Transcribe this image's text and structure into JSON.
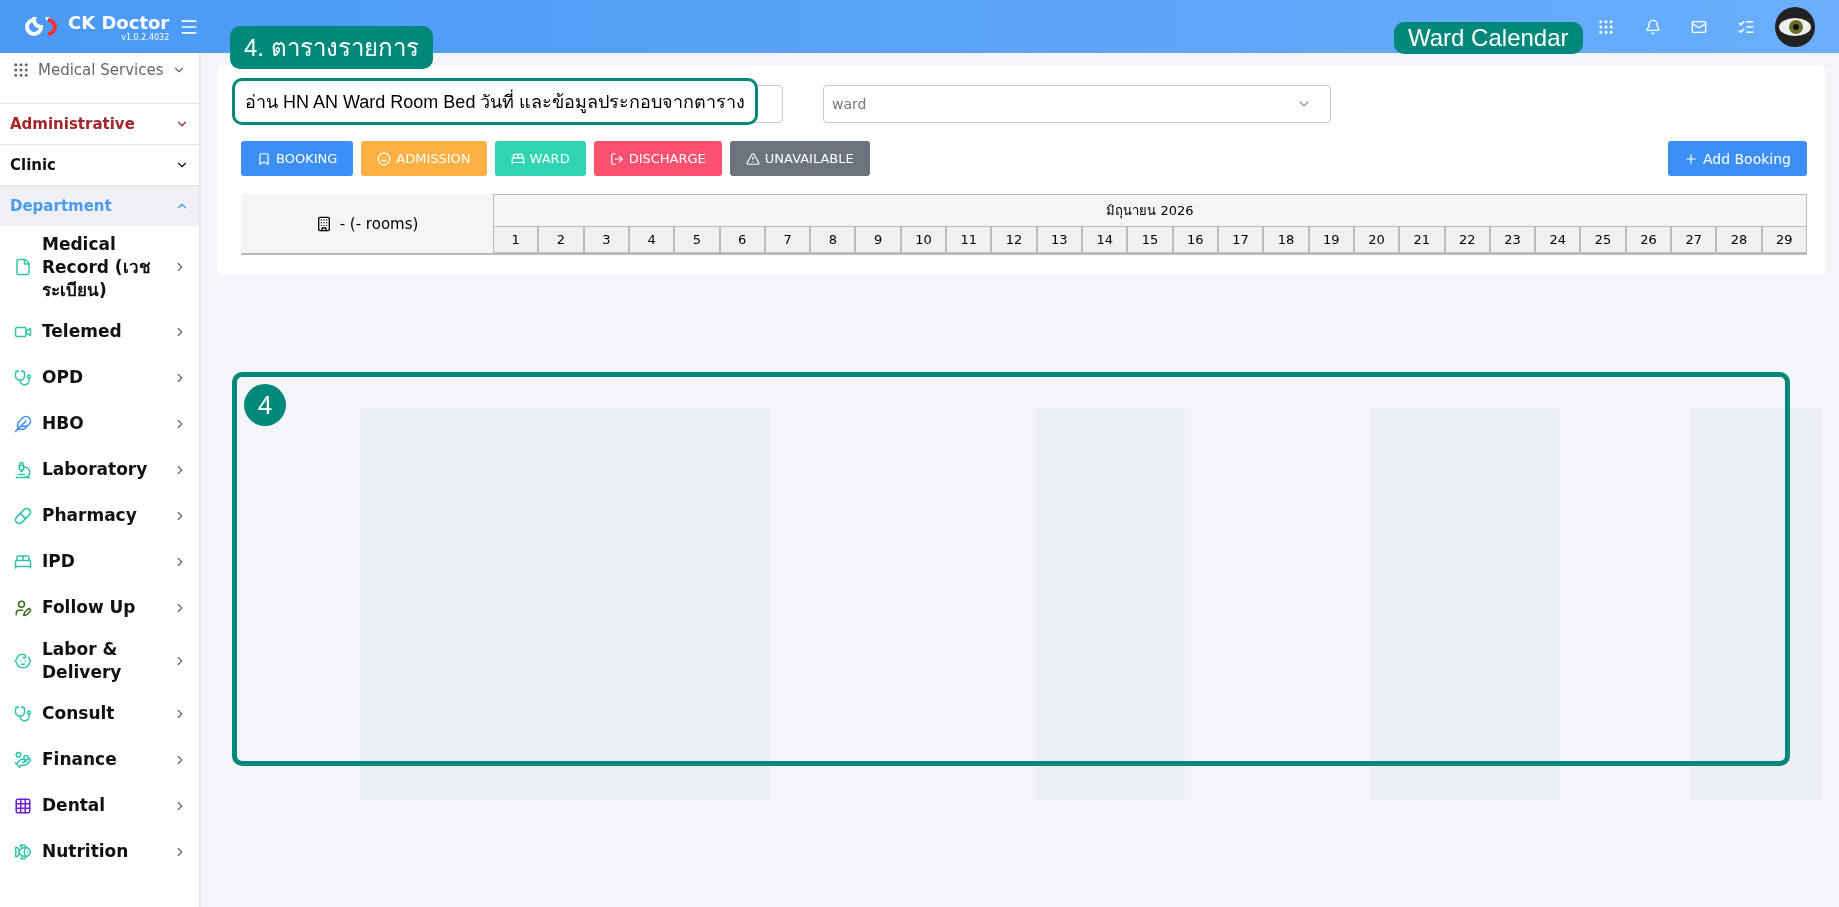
{
  "header": {
    "brand": "CK Doctor",
    "version": "v1.0.2.4032"
  },
  "sidebar": {
    "services": "Medical Services",
    "groups": [
      {
        "label": "Administrative",
        "expanded": false,
        "color": "#a3262a"
      },
      {
        "label": "Clinic",
        "expanded": false,
        "color": "#111111"
      },
      {
        "label": "Department",
        "expanded": true,
        "color": "#4a9af0"
      }
    ],
    "items": [
      "Medical Record (เวชระเบียน)",
      "Telemed",
      "OPD",
      "HBO",
      "Laboratory",
      "Pharmacy",
      "IPD",
      "Follow Up",
      "Labor & Delivery",
      "Consult",
      "Finance",
      "Dental",
      "Nutrition"
    ]
  },
  "filters": {
    "ward_placeholder": "ward"
  },
  "legend": [
    {
      "label": "BOOKING",
      "color": "#3d8ef5"
    },
    {
      "label": "ADMISSION",
      "color": "#fdb144"
    },
    {
      "label": "WARD",
      "color": "#2fd4b3"
    },
    {
      "label": "DISCHARGE",
      "color": "#fd5170"
    },
    {
      "label": "UNAVAILABLE",
      "color": "#6c737c"
    }
  ],
  "add_button": "Add Booking",
  "calendar": {
    "rooms": "- (- rooms)",
    "month": "มิถุนายน 2026",
    "days": [
      "1",
      "2",
      "3",
      "4",
      "5",
      "6",
      "7",
      "8",
      "9",
      "10",
      "11",
      "12",
      "13",
      "14",
      "15",
      "16",
      "17",
      "18",
      "19",
      "20",
      "21",
      "22",
      "23",
      "24",
      "25",
      "26",
      "27",
      "28",
      "29"
    ]
  },
  "annotations": {
    "section_tag": "4. ตารางรายการ",
    "page_tag": "Ward Calendar",
    "note": "อ่าน HN AN Ward Room Bed วันที่ และข้อมูลประกอบจากตาราง",
    "badge": "4"
  }
}
